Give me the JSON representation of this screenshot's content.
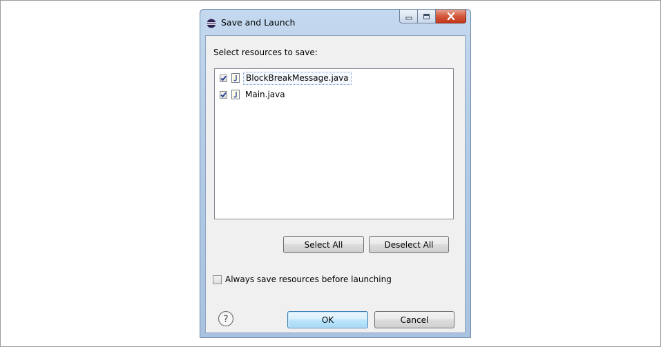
{
  "window": {
    "title": "Save and Launch"
  },
  "dialog": {
    "prompt": "Select resources to save:",
    "resources": [
      {
        "name": "BlockBreakMessage.java",
        "checked": true,
        "focused": true
      },
      {
        "name": "Main.java",
        "checked": true,
        "focused": false
      }
    ],
    "select_all_label": "Select All",
    "deselect_all_label": "Deselect All",
    "always_save_label": "Always save resources before launching",
    "always_save_checked": false,
    "ok_label": "OK",
    "cancel_label": "Cancel"
  },
  "icons": {
    "app": "eclipse-icon",
    "file": "java-file-icon",
    "help": "help-icon"
  },
  "colors": {
    "titlebar": "#b9cfe9",
    "close_button": "#c9452a",
    "checkmark": "#1f3a8a",
    "ok_border": "#3c7fb1"
  }
}
